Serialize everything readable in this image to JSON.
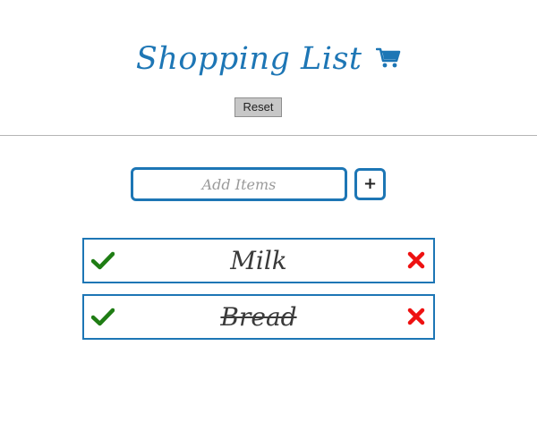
{
  "header": {
    "title": "Shopping List",
    "cart_icon": "cart-icon",
    "reset_label": "Reset"
  },
  "add_form": {
    "input_placeholder": "Add Items",
    "input_value": "",
    "add_button_label": "+"
  },
  "items": [
    {
      "name": "Milk",
      "completed": false
    },
    {
      "name": "Bread",
      "completed": true
    }
  ],
  "colors": {
    "accent": "#1d76b5",
    "check": "#1f7d14",
    "remove": "#ee1111",
    "divider": "#b5b5b5"
  },
  "icons": {
    "check": "check-icon",
    "remove": "close-icon"
  }
}
